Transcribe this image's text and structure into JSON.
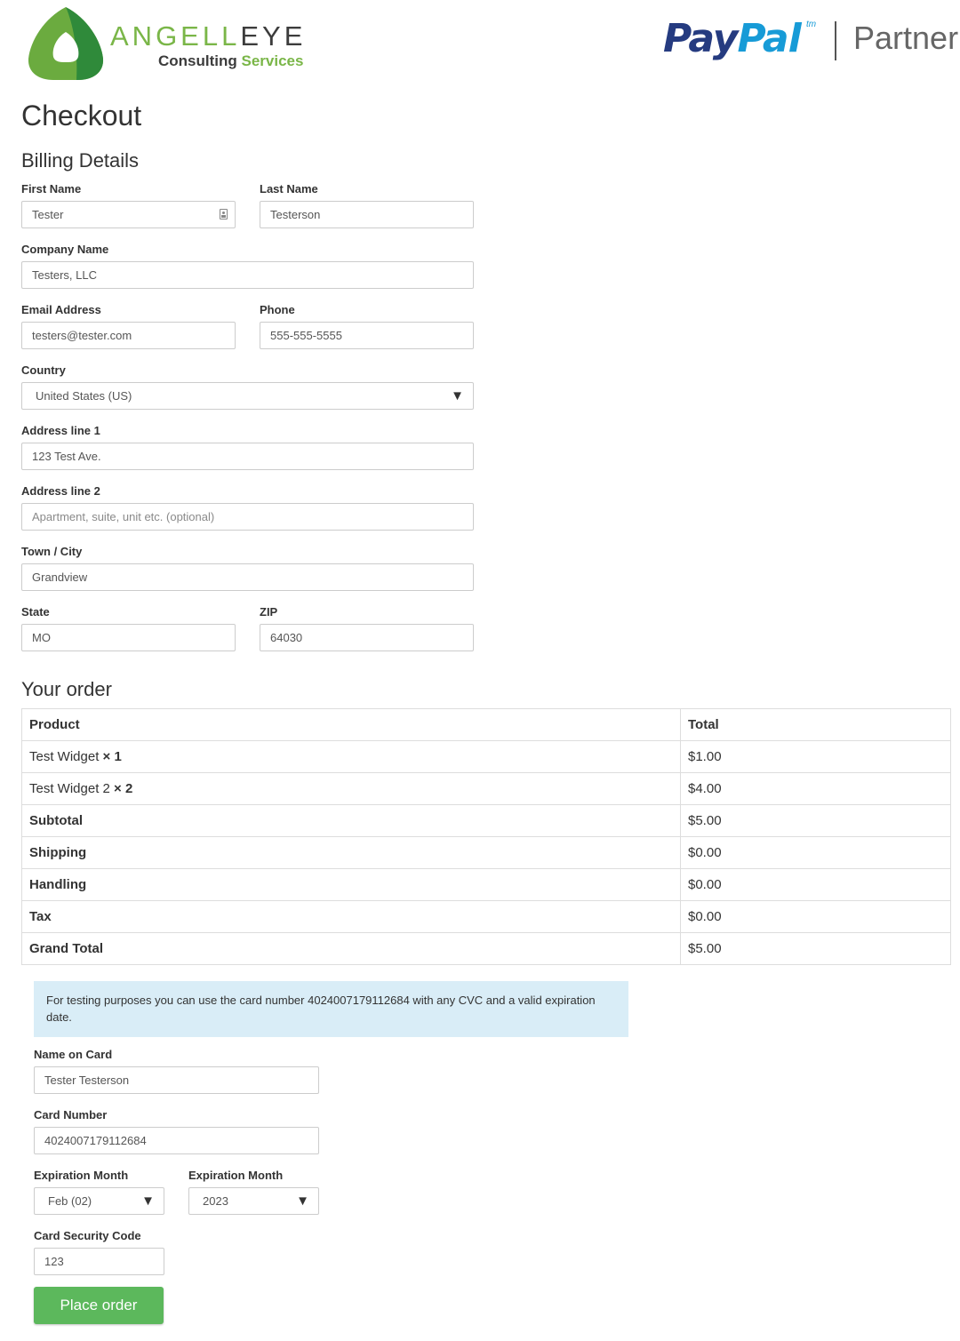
{
  "header": {
    "brand": {
      "name_part1": "ANGELL",
      "name_part2": "EYE",
      "tagline_part1": "Consulting ",
      "tagline_part2": "Services"
    },
    "paypal": {
      "word_part1": "Pay",
      "word_part2": "Pal",
      "tm": "tm",
      "partner": "Partner"
    }
  },
  "page_title": "Checkout",
  "billing": {
    "heading": "Billing Details",
    "first_name": {
      "label": "First Name",
      "value": "Tester"
    },
    "last_name": {
      "label": "Last Name",
      "value": "Testerson"
    },
    "company": {
      "label": "Company Name",
      "value": "Testers, LLC"
    },
    "email": {
      "label": "Email Address",
      "value": "testers@tester.com"
    },
    "phone": {
      "label": "Phone",
      "value": "555-555-5555"
    },
    "country": {
      "label": "Country",
      "value": "United States (US)"
    },
    "address1": {
      "label": "Address line 1",
      "value": "123 Test Ave."
    },
    "address2": {
      "label": "Address line 2",
      "placeholder": "Apartment, suite, unit etc. (optional)"
    },
    "city": {
      "label": "Town / City",
      "value": "Grandview"
    },
    "state": {
      "label": "State",
      "value": "MO"
    },
    "zip": {
      "label": "ZIP",
      "value": "64030"
    }
  },
  "order": {
    "heading": "Your order",
    "columns": [
      "Product",
      "Total"
    ],
    "items": [
      {
        "name": "Test Widget",
        "qty": "× 1",
        "total": "$1.00"
      },
      {
        "name": "Test Widget 2",
        "qty": "× 2",
        "total": "$4.00"
      }
    ],
    "summary": [
      {
        "label": "Subtotal",
        "value": "$5.00"
      },
      {
        "label": "Shipping",
        "value": "$0.00"
      },
      {
        "label": "Handling",
        "value": "$0.00"
      },
      {
        "label": "Tax",
        "value": "$0.00"
      },
      {
        "label": "Grand Total",
        "value": "$5.00"
      }
    ]
  },
  "payment": {
    "notice": "For testing purposes you can use the card number 4024007179112684 with any CVC and a valid expiration date.",
    "name_on_card": {
      "label": "Name on Card",
      "value": "Tester Testerson"
    },
    "card_number": {
      "label": "Card Number",
      "value": "4024007179112684"
    },
    "exp_month": {
      "label": "Expiration Month",
      "value": "Feb (02)"
    },
    "exp_year": {
      "label": "Expiration Month",
      "value": "2023"
    },
    "cvc": {
      "label": "Card Security Code",
      "value": "123"
    },
    "place_order": "Place order"
  },
  "colors": {
    "brand_green": "#7ab648",
    "paypal_dark": "#253b80",
    "paypal_light": "#179bd7",
    "button_green": "#5cb85c",
    "notice_bg": "#d9edf7"
  },
  "icons": {
    "select_arrow": "▼",
    "autofill": "contact-card-icon"
  }
}
